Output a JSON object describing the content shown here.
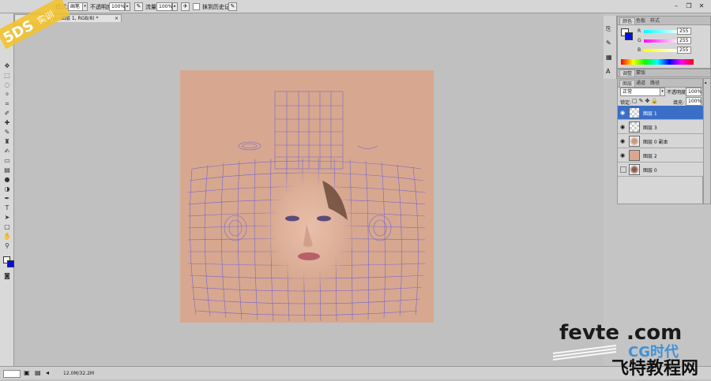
{
  "options_bar": {
    "mode_label": "模式:",
    "mode_value": "画笔",
    "opacity_label": "不透明度:",
    "opacity_value": "100%",
    "flow_label": "流量:",
    "flow_value": "100%",
    "history_label": "抹到历史记录"
  },
  "document_tab": {
    "title": "% (图层 1, RGB/8) *"
  },
  "color_panel": {
    "tabs": [
      "颜色",
      "色板",
      "样式"
    ],
    "channels": [
      {
        "name": "R",
        "value": "255"
      },
      {
        "name": "G",
        "value": "255"
      },
      {
        "name": "B",
        "value": "255"
      }
    ]
  },
  "adjust_panel": {
    "tabs": [
      "调整",
      "蒙版"
    ]
  },
  "layers_panel": {
    "tabs": [
      "图层",
      "通道",
      "路径"
    ],
    "blend_mode": "正常",
    "opacity_label": "不透明度:",
    "opacity_value": "100%",
    "lock_label": "锁定:",
    "fill_label": "填充:",
    "fill_value": "100%",
    "layers": [
      {
        "name": "图层 1",
        "selected": true,
        "visible": true,
        "thumb": "checker"
      },
      {
        "name": "图层 3",
        "selected": false,
        "visible": true,
        "thumb": "checker"
      },
      {
        "name": "图层 0 副本",
        "selected": false,
        "visible": true,
        "thumb": "face"
      },
      {
        "name": "图层 2",
        "selected": false,
        "visible": true,
        "thumb": "skin"
      },
      {
        "name": "图层 0",
        "selected": false,
        "visible": false,
        "thumb": "face"
      }
    ]
  },
  "status_bar": {
    "zoom": "",
    "doc_size": "12.0M/32.2M"
  },
  "watermarks": {
    "top_left_logo": "5DS",
    "top_left_sub": "实训",
    "bottom_right_1": "fevte .com",
    "bottom_right_2": "飞特教程网",
    "bottom_right_3": "CG时代"
  },
  "colors": {
    "canvas_skin": "#d7a88f",
    "mesh": "#6a5bd8",
    "selection": "#3a6fc8"
  }
}
